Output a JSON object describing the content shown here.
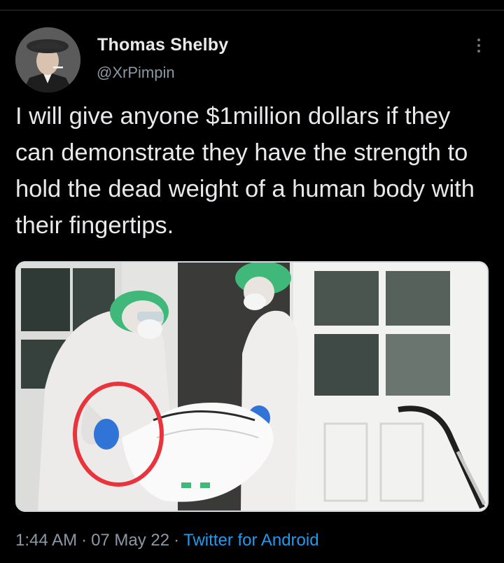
{
  "tweet": {
    "author": {
      "display_name": "Thomas Shelby",
      "handle": "@XrPimpin"
    },
    "text": "I will give anyone $1million dollars if they can demonstrate they have the strength to hold the dead weight of a human body with their fingertips.",
    "meta": {
      "time": "1:44 AM",
      "separator": "·",
      "date": "07 May 22",
      "source": "Twitter for Android"
    }
  },
  "icons": {
    "more": "more-vertical-icon"
  },
  "colors": {
    "background": "#000000",
    "text": "#e7e9ea",
    "secondary": "#8b98a5",
    "link": "#1d9bf0",
    "annotation_circle": "#e8343a",
    "cap": "#3fb87a",
    "glove": "#2f74d6"
  }
}
